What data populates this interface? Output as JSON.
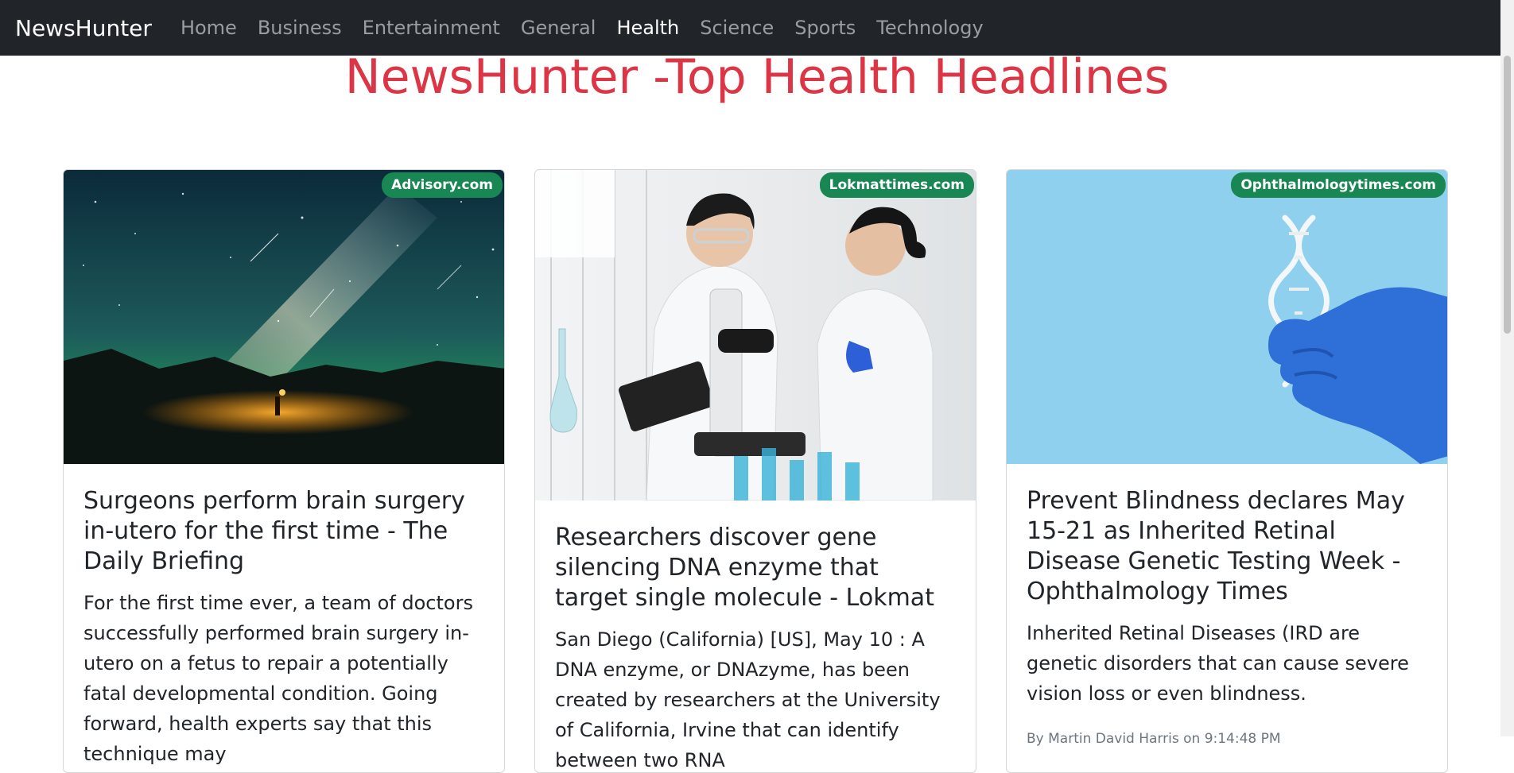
{
  "navbar": {
    "brand": "NewsHunter",
    "links": [
      "Home",
      "Business",
      "Entertainment",
      "General",
      "Health",
      "Science",
      "Sports",
      "Technology"
    ],
    "active": "Health"
  },
  "page": {
    "title": "NewsHunter -Top Health Headlines"
  },
  "articles": [
    {
      "source": "Advisory.com",
      "image_icon": "night-sky-milky-way-image",
      "title": "Surgeons perform brain surgery in-utero for the first time - The Daily Briefing",
      "description": "For the first time ever, a team of doctors successfully performed brain surgery in-utero on a fetus to repair a potentially fatal developmental condition. Going forward, health experts say that this technique may"
    },
    {
      "source": "Lokmattimes.com",
      "image_icon": "lab-scientists-microscope-image",
      "title": "Researchers discover gene silencing DNA enzyme that target single molecule - Lokmat",
      "description": "San Diego (California) [US], May 10 : A DNA enzyme, or DNAzyme, has been created by researchers at the University of California, Irvine that can identify between two RNA"
    },
    {
      "source": "Ophthalmologytimes.com",
      "image_icon": "dna-helix-gloved-hand-image",
      "title": "Prevent Blindness declares May 15-21 as Inherited Retinal Disease Genetic Testing Week - Ophthalmology Times",
      "description": "Inherited Retinal Diseases (IRD are genetic disorders that can cause severe vision loss or even blindness.",
      "author": "By Martin David Harris on 9:14:48 PM"
    }
  ],
  "colors": {
    "navbar_bg": "#212529",
    "title": "#dc3545",
    "badge": "#198754"
  }
}
